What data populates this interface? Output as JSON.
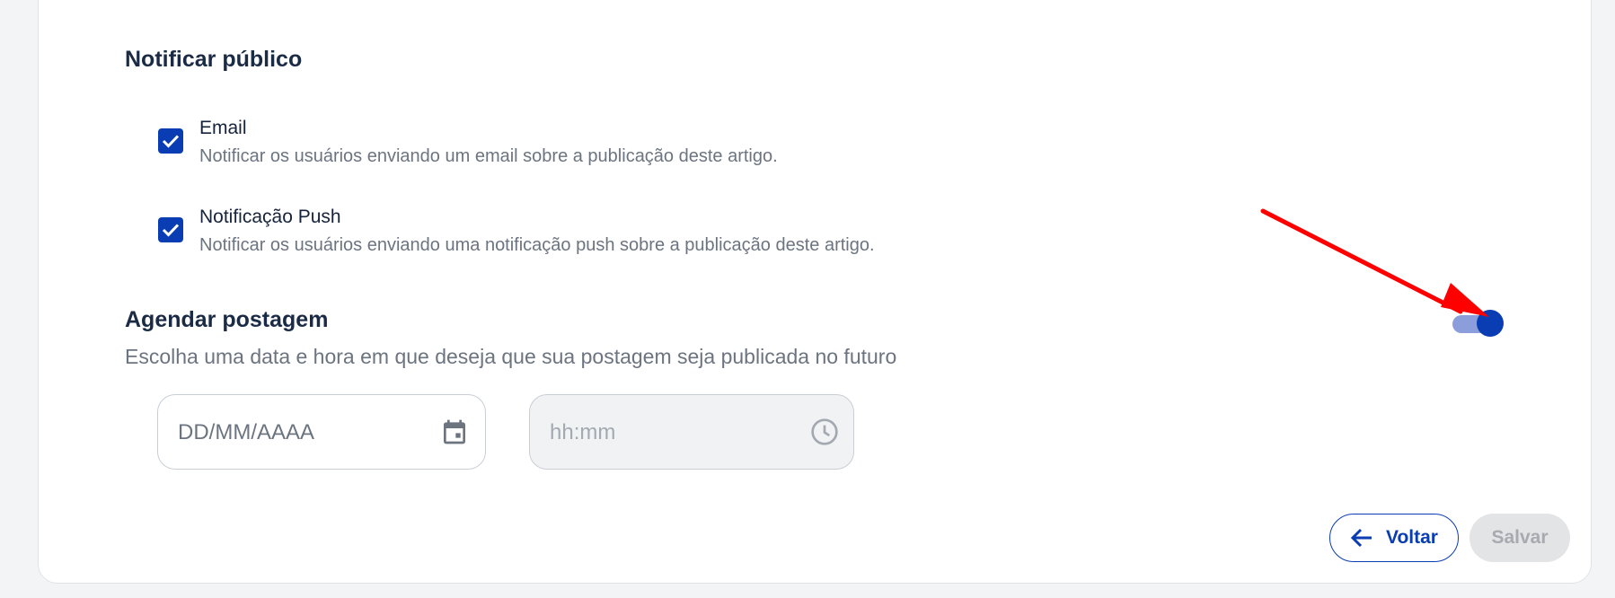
{
  "notify": {
    "title": "Notificar público",
    "options": [
      {
        "label": "Email",
        "description": "Notificar os usuários enviando um email sobre a publicação deste artigo.",
        "checked": true
      },
      {
        "label": "Notificação Push",
        "description": "Notificar os usuários enviando uma notificação push sobre a publicação deste artigo.",
        "checked": true
      }
    ]
  },
  "schedule": {
    "title": "Agendar postagem",
    "subtitle": "Escolha uma data e hora em que deseja que sua postagem seja publicada no futuro",
    "toggle_on": true,
    "date_placeholder": "DD/MM/AAAA",
    "date_icon": "calendar-icon",
    "time_placeholder": "hh:mm",
    "time_icon": "clock-icon",
    "time_disabled": true
  },
  "actions": {
    "back_label": "Voltar",
    "back_icon": "arrow-left-icon",
    "save_label": "Salvar",
    "save_disabled": true
  },
  "colors": {
    "primary": "#0a3db3",
    "toggle_track": "#8b9edb",
    "annotation_arrow": "#ff0000"
  }
}
